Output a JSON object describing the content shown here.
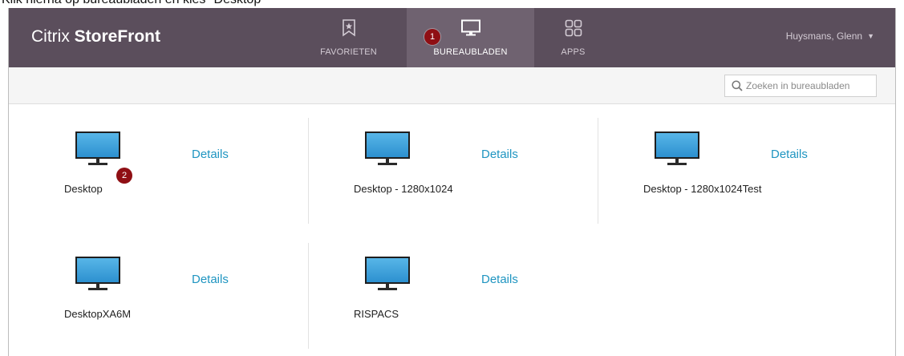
{
  "caption": "Klik hierna op bureaubladen en kies \"Desktop\"",
  "brand": {
    "light": "Citrix ",
    "bold": "StoreFront"
  },
  "nav": {
    "tabs": [
      {
        "label": "FAVORIETEN",
        "icon": "bookmark-star-icon",
        "active": false
      },
      {
        "label": "BUREAUBLADEN",
        "icon": "monitor-icon",
        "active": true
      },
      {
        "label": "APPS",
        "icon": "app-grid-icon",
        "active": false
      }
    ]
  },
  "user": {
    "name": "Huysmans, Glenn",
    "caret": "▼"
  },
  "search": {
    "placeholder": "Zoeken in bureaubladen",
    "value": ""
  },
  "badges": [
    "1",
    "2"
  ],
  "desktops": [
    {
      "name": "Desktop",
      "details_label": "Details"
    },
    {
      "name": "Desktop - 1280x1024",
      "details_label": "Details"
    },
    {
      "name": "Desktop - 1280x1024Test",
      "details_label": "Details"
    },
    {
      "name": "DesktopXA6M",
      "details_label": "Details"
    },
    {
      "name": "RISPACS",
      "details_label": "Details"
    }
  ],
  "colors": {
    "topbar": "#5b4e5c",
    "active_tab": "#6f6270",
    "badge": "#8f0f14",
    "link": "#1f95c1",
    "monitor_screen": "#3aa0d8"
  }
}
